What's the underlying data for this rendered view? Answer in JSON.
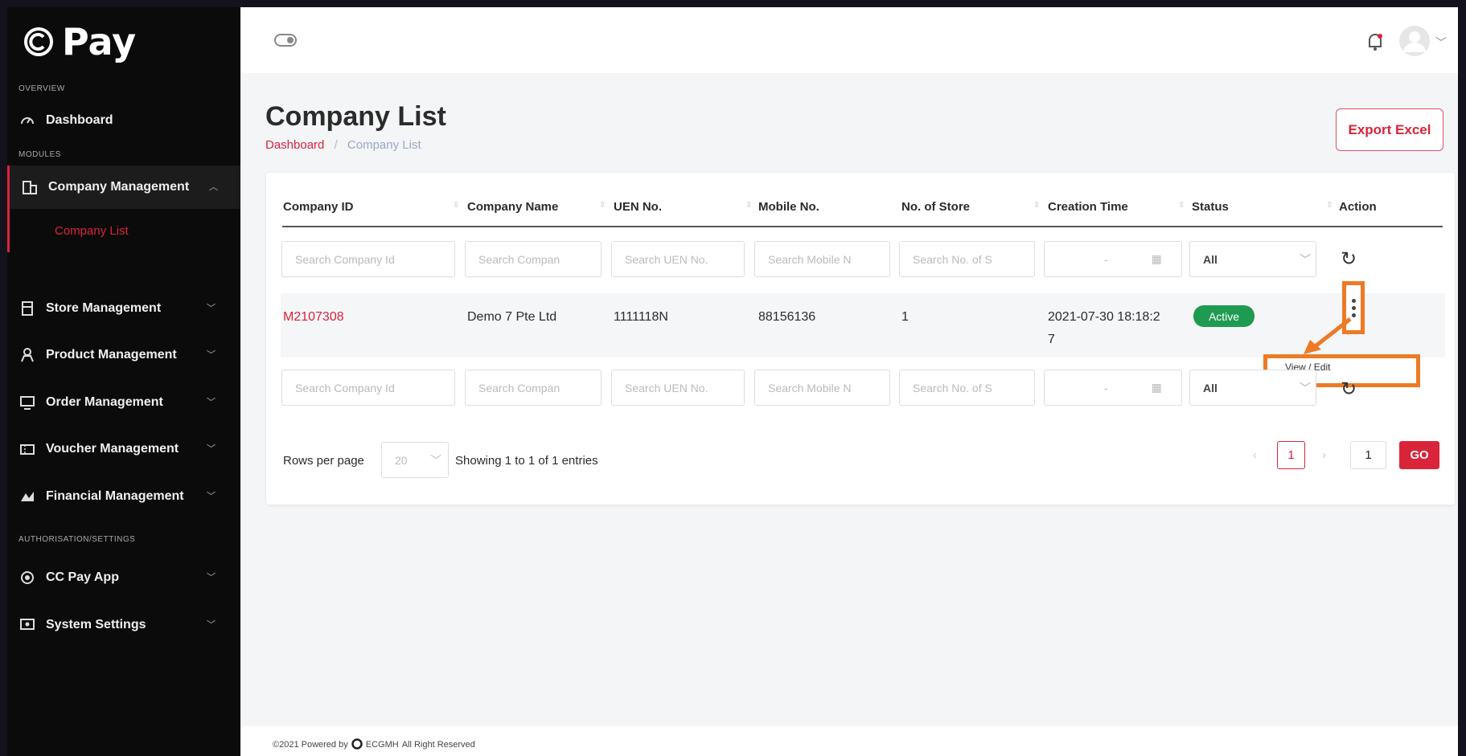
{
  "app": {
    "logo_text": "Pay"
  },
  "sidebar": {
    "sections": {
      "overview": "OVERVIEW",
      "modules": "MODULES",
      "auth": "AUTHORISATION/SETTINGS"
    },
    "items": [
      {
        "label": "Dashboard",
        "icon": "speedometer-icon"
      },
      {
        "label": "Company Management",
        "icon": "building-icon"
      },
      {
        "label": "Store Management",
        "icon": "store-icon"
      },
      {
        "label": "Product Management",
        "icon": "product-icon"
      },
      {
        "label": "Order Management",
        "icon": "order-icon"
      },
      {
        "label": "Voucher Management",
        "icon": "voucher-icon"
      },
      {
        "label": "Financial Management",
        "icon": "money-icon"
      },
      {
        "label": "CC Pay App",
        "icon": "app-icon"
      },
      {
        "label": "System Settings",
        "icon": "settings-icon"
      }
    ],
    "sub_item": "Company List"
  },
  "page": {
    "title": "Company List",
    "breadcrumb": {
      "root": "Dashboard",
      "separator": "/",
      "current": "Company List"
    },
    "export_label": "Export Excel"
  },
  "table": {
    "headers": [
      "Company ID",
      "Company Name",
      "UEN No.",
      "Mobile No.",
      "No. of Store",
      "Creation Time",
      "Status",
      "Action"
    ],
    "filters": [
      "Search Company Id",
      "Search Compan",
      "Search UEN No.",
      "Search Mobile N",
      "Search No. of S",
      "-"
    ],
    "status_filter": "All",
    "row": {
      "company_id": "M2107308",
      "company_name": "Demo 7 Pte Ltd",
      "uen": "1111118N",
      "mobile": "88156136",
      "stores": "1",
      "created_line1": "2021-07-30 18:18:2",
      "created_line2": "7",
      "status": "Active"
    },
    "action_menu": "View / Edit"
  },
  "pagination": {
    "rows_label": "Rows per page",
    "rows_value": "20",
    "info": "Showing 1 to 1 of 1 entries",
    "current_page": "1",
    "goto_value": "1",
    "go_label": "GO"
  },
  "footer": {
    "prefix": "©2021 Powered by",
    "brand": "ECGMH",
    "suffix": "All Right Reserved"
  },
  "colors": {
    "accent": "#d9243a",
    "highlight": "#ee7a25",
    "active": "#1f9a52"
  }
}
